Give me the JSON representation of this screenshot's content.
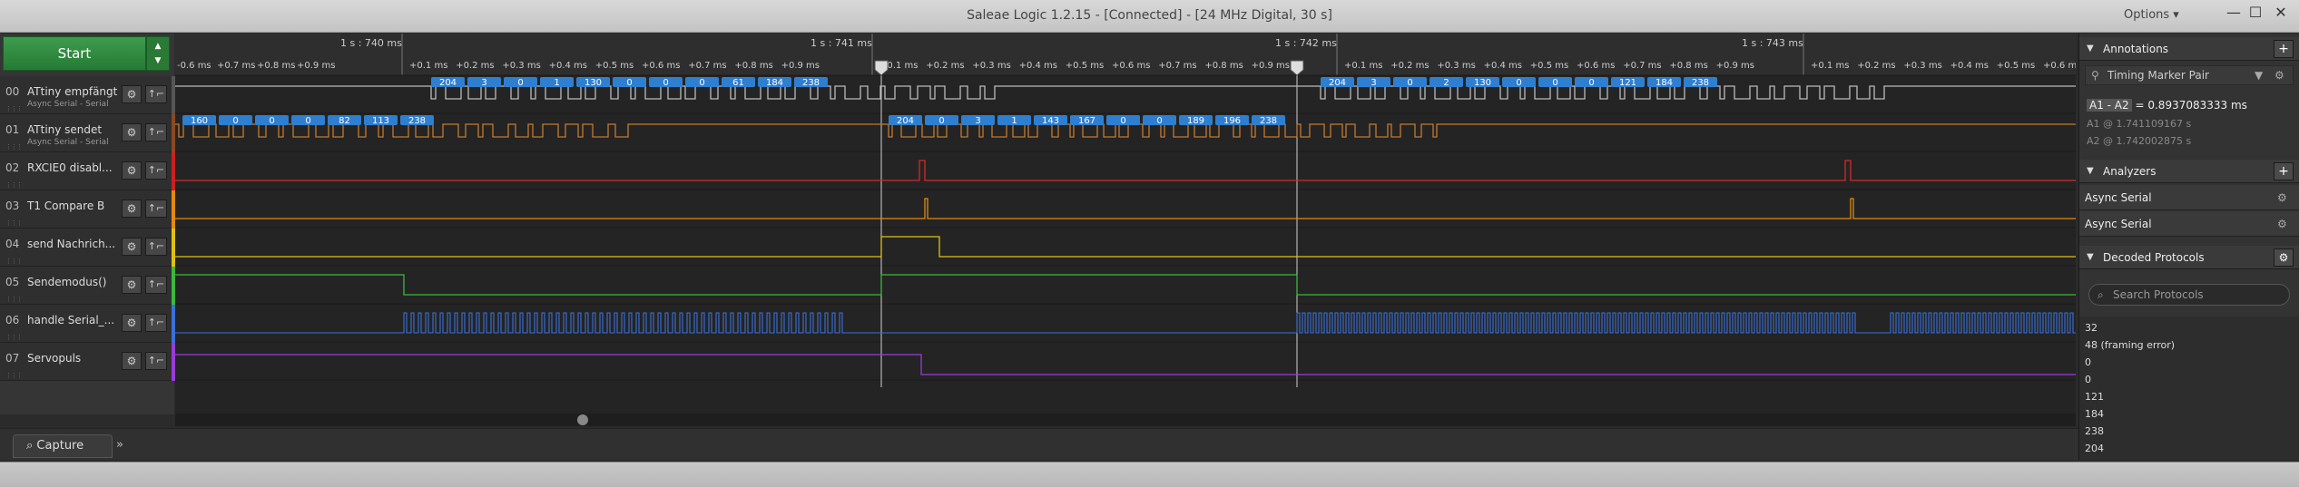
{
  "window": {
    "title": "Saleae Logic 1.2.15 - [Connected] - [24 MHz Digital, 30 s]",
    "options_label": "Options ▾",
    "minimize": "—",
    "maximize": "☐",
    "close": "✕"
  },
  "toolbar": {
    "start_label": "Start"
  },
  "timeline": {
    "major_ticks": [
      "1 s : 740 ms",
      "1 s : 741 ms",
      "1 s : 742 ms",
      "1 s : 743 ms"
    ],
    "minor_prefix_first": [
      "-0.6 ms",
      "+0.7 ms",
      "+0.8 ms",
      "+0.9 ms"
    ],
    "minor_cycle": [
      "+0.1 ms",
      "+0.2 ms",
      "+0.3 ms",
      "+0.4 ms",
      "+0.5 ms",
      "+0.6 ms",
      "+0.7 ms",
      "+0.8 ms",
      "+0.9 ms"
    ],
    "marker_first_label": "1 ms"
  },
  "channels": [
    {
      "num": "00",
      "name": "ATtiny empfängt",
      "sub": "Async Serial - Serial",
      "color": "#555555"
    },
    {
      "num": "01",
      "name": "ATtiny sendet",
      "sub": "Async Serial - Serial",
      "color": "#8a4a20"
    },
    {
      "num": "02",
      "name": "RXCIE0 disabl...",
      "sub": "",
      "color": "#cc2020"
    },
    {
      "num": "03",
      "name": "T1 Compare B",
      "sub": "",
      "color": "#e08a10"
    },
    {
      "num": "04",
      "name": "send Nachrich...",
      "sub": "",
      "color": "#e0c010"
    },
    {
      "num": "05",
      "name": "Sendemodus()",
      "sub": "",
      "color": "#3cb83c"
    },
    {
      "num": "06",
      "name": "handle Serial_...",
      "sub": "",
      "color": "#3a70d8"
    },
    {
      "num": "07",
      "name": "Servopuls",
      "sub": "",
      "color": "#9a3ad8"
    }
  ],
  "decodes": {
    "ch0_group1": [
      "204",
      "3",
      "0",
      "1",
      "130",
      "0",
      "0",
      "0",
      "61",
      "184",
      "238"
    ],
    "ch0_group2": [
      "204",
      "3",
      "0",
      "2",
      "130",
      "0",
      "0",
      "0",
      "121",
      "184",
      "238"
    ],
    "ch1_group0": [
      "160",
      "0",
      "0",
      "0",
      "82",
      "113",
      "238"
    ],
    "ch1_group1": [
      "204",
      "0",
      "3",
      "1",
      "143",
      "167",
      "0",
      "0",
      "189",
      "196",
      "238"
    ]
  },
  "annotations": {
    "header": "Annotations",
    "marker_pair": "Timing Marker Pair",
    "delta_label": "A1 - A2",
    "delta_value": "= 0.8937083333 ms",
    "a1_label": "A1",
    "a1_value": "@ 1.741109167 s",
    "a2_label": "A2",
    "a2_value": "@ 1.742002875 s"
  },
  "analyzers": {
    "header": "Analyzers",
    "items": [
      "Async Serial",
      "Async Serial"
    ]
  },
  "decoded_protocols": {
    "header": "Decoded Protocols",
    "search_placeholder": "Search Protocols",
    "items": [
      "32",
      "48 (framing error)",
      "0",
      "0",
      "121",
      "184",
      "238",
      "204"
    ]
  },
  "bottom": {
    "capture_tab": "Capture",
    "more": "»"
  }
}
